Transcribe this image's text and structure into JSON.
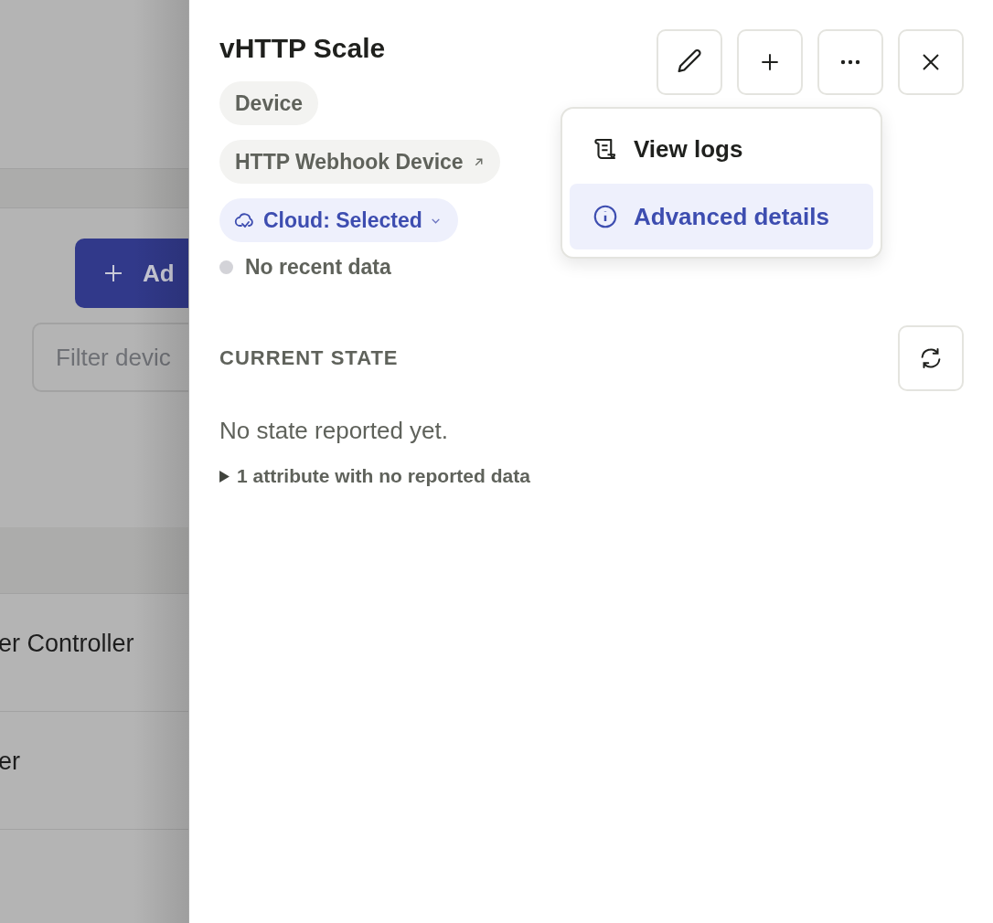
{
  "background": {
    "add_button": "Ad",
    "filter": {
      "placeholder": "Filter devic"
    },
    "rows": [
      {
        "text": "er Controller"
      },
      {
        "text": "er"
      }
    ]
  },
  "panel": {
    "title": "vHTTP Scale",
    "tags": [
      {
        "kind": "plain",
        "label": "Device"
      },
      {
        "kind": "link",
        "label": "HTTP Webhook Device"
      },
      {
        "kind": "dropdown",
        "label": "Cloud: Selected"
      }
    ],
    "status": "No recent data",
    "toolbar": [
      {
        "kind": "edit"
      },
      {
        "kind": "add"
      },
      {
        "kind": "more"
      },
      {
        "kind": "close"
      }
    ],
    "menu": [
      {
        "kind": "logs",
        "label": "View logs",
        "selected": false
      },
      {
        "kind": "info",
        "label": "Advanced details",
        "selected": true
      }
    ],
    "section": {
      "heading": "CURRENT STATE",
      "empty": "No state reported yet.",
      "disclosure": {
        "label": "1 attribute with no reported data",
        "expanded": false
      }
    }
  }
}
